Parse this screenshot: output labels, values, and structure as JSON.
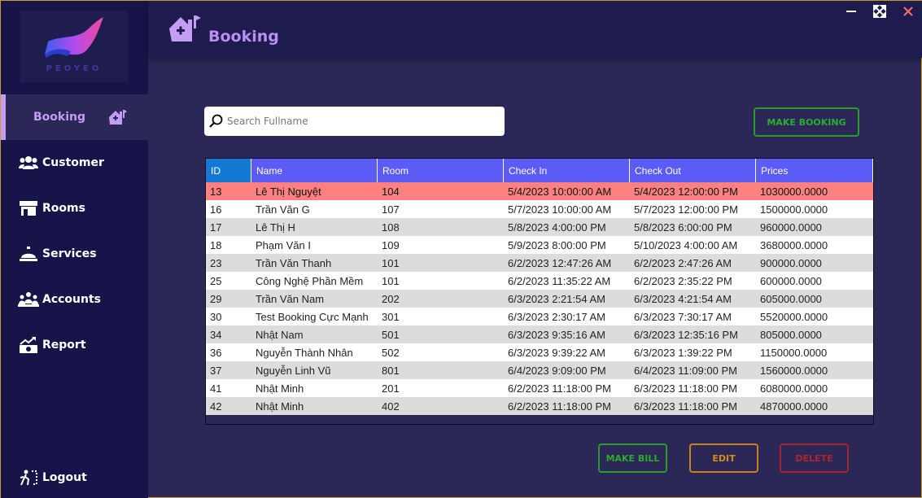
{
  "app": {
    "logo_text": "PEOYEO",
    "page_title": "Booking",
    "colors": {
      "accent": "#c59df5",
      "sidebar": "#17144a",
      "content": "#2b2757",
      "grid_header": "#5b5cf6",
      "selected_row": "#ff8080"
    }
  },
  "window": {
    "minimize_icon": "minimize-icon",
    "maximize_icon": "maximize-icon",
    "close_icon": "close-icon"
  },
  "sidebar": {
    "items": [
      {
        "label": "Booking",
        "icon": "house-plus-icon",
        "active": true
      },
      {
        "label": "Customer",
        "icon": "users-icon",
        "active": false
      },
      {
        "label": "Rooms",
        "icon": "store-icon",
        "active": false
      },
      {
        "label": "Services",
        "icon": "bell-icon",
        "active": false
      },
      {
        "label": "Accounts",
        "icon": "people-group-icon",
        "active": false
      },
      {
        "label": "Report",
        "icon": "chart-money-icon",
        "active": false
      }
    ],
    "logout": {
      "label": "Logout",
      "icon": "door-exit-icon"
    }
  },
  "search": {
    "placeholder": "Search Fullname",
    "value": ""
  },
  "buttons": {
    "make_booking": "MAKE BOOKING",
    "make_bill": "MAKE BILL",
    "edit": "EDIT",
    "delete": "DELETE"
  },
  "table": {
    "columns": [
      "ID",
      "Name",
      "Room",
      "Check In",
      "Check Out",
      "Prices"
    ],
    "rows": [
      [
        "13",
        "Lê Thị Nguyệt",
        "104",
        "5/4/2023 10:00:00 AM",
        "5/4/2023 12:00:00 PM",
        "1030000.0000"
      ],
      [
        "16",
        "Trần Văn G",
        "107",
        "5/7/2023 10:00:00 AM",
        "5/7/2023 12:00:00 PM",
        "1500000.0000"
      ],
      [
        "17",
        "Lê Thị H",
        "108",
        "5/8/2023 4:00:00 PM",
        "5/8/2023 6:00:00 PM",
        "960000.0000"
      ],
      [
        "18",
        "Phạm Văn I",
        "109",
        "5/9/2023 8:00:00 PM",
        "5/10/2023 4:00:00 AM",
        "3680000.0000"
      ],
      [
        "23",
        "Trần Văn Thanh",
        "101",
        "6/2/2023 12:47:26 AM",
        "6/2/2023 2:47:26 AM",
        "900000.0000"
      ],
      [
        "25",
        "Công Nghệ Phần Mềm",
        "101",
        "6/2/2023 11:35:22 AM",
        "6/2/2023 2:35:22 PM",
        "600000.0000"
      ],
      [
        "29",
        "Trần Văn Nam",
        "202",
        "6/3/2023 2:21:54 AM",
        "6/3/2023 4:21:54 AM",
        "605000.0000"
      ],
      [
        "30",
        "Test Booking Cực Mạnh",
        "301",
        "6/3/2023 2:30:17 AM",
        "6/3/2023 7:30:17 AM",
        "5520000.0000"
      ],
      [
        "34",
        "Nhật Nam",
        "501",
        "6/3/2023 9:35:16 AM",
        "6/3/2023 12:35:16 PM",
        "805000.0000"
      ],
      [
        "36",
        "Nguyễn Thành Nhân",
        "502",
        "6/3/2023 9:39:22 AM",
        "6/3/2023 1:39:22 PM",
        "1150000.0000"
      ],
      [
        "37",
        "Nguyễn Linh Vũ",
        "801",
        "6/4/2023 9:09:00 PM",
        "6/4/2023 11:09:00 PM",
        "1560000.0000"
      ],
      [
        "41",
        "Nhật Minh",
        "201",
        "6/2/2023 11:18:00 PM",
        "6/3/2023 11:18:00 PM",
        "6080000.0000"
      ],
      [
        "42",
        "Nhật Minh",
        "402",
        "6/2/2023 11:18:00 PM",
        "6/3/2023 11:18:00 PM",
        "4870000.0000"
      ]
    ],
    "selected_row": 0
  }
}
